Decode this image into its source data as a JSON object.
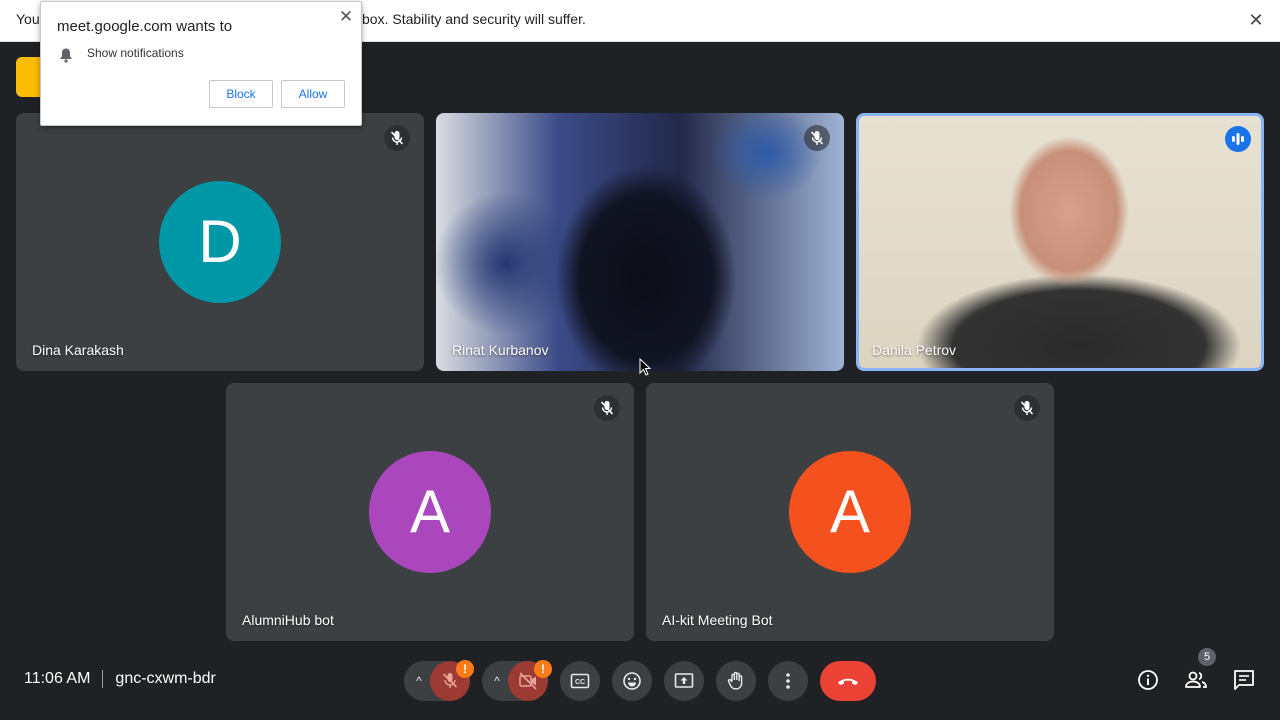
{
  "warning_bar": {
    "text_left": "You",
    "text": "box. Stability and security will suffer.",
    "close_icon": "close-icon"
  },
  "popup": {
    "title": "meet.google.com wants to",
    "permission": "Show notifications",
    "block_label": "Block",
    "allow_label": "Allow"
  },
  "participants": [
    {
      "name": "Dina Karakash",
      "initial": "D",
      "color": "#0097a7",
      "muted": true
    },
    {
      "name": "Rinat Kurbanov",
      "initial": "",
      "muted": true
    },
    {
      "name": "Danila Petrov",
      "initial": "",
      "speaking": true
    },
    {
      "name": "AlumniHub bot",
      "initial": "A",
      "color": "#ab47bc",
      "muted": true
    },
    {
      "name": "AI-kit Meeting Bot",
      "initial": "A",
      "color": "#f4511e",
      "muted": true
    }
  ],
  "bottom_bar": {
    "time": "11:06 AM",
    "meeting_code": "gnc-cxwm-bdr",
    "warning_badge": "!",
    "people_count": "5"
  },
  "colors": {
    "background": "#202124",
    "tile": "#3c4043",
    "end_call": "#ea4335",
    "speaking_border": "#8ab4f8"
  }
}
